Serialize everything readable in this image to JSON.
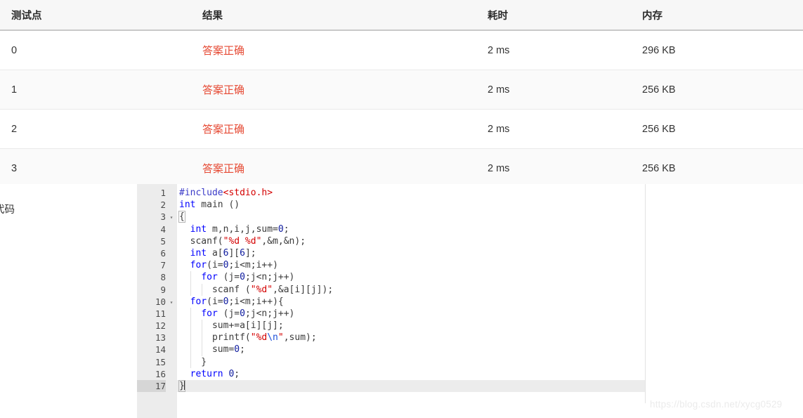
{
  "table": {
    "columns": [
      {
        "key": "case",
        "label": "测试点"
      },
      {
        "key": "result",
        "label": "结果"
      },
      {
        "key": "time",
        "label": "耗时"
      },
      {
        "key": "memory",
        "label": "内存"
      }
    ],
    "rows": [
      {
        "case": "0",
        "result": "答案正确",
        "time": "2 ms",
        "memory": "296 KB"
      },
      {
        "case": "1",
        "result": "答案正确",
        "time": "2 ms",
        "memory": "256 KB"
      },
      {
        "case": "2",
        "result": "答案正确",
        "time": "2 ms",
        "memory": "256 KB"
      },
      {
        "case": "3",
        "result": "答案正确",
        "time": "2 ms",
        "memory": "256 KB"
      }
    ],
    "verdict_color": "#e64a34"
  },
  "code_panel": {
    "label": "代码",
    "language": "c",
    "active_line": 17,
    "line_numbers": [
      "1",
      "2",
      "3",
      "4",
      "5",
      "6",
      "7",
      "8",
      "9",
      "10",
      "11",
      "12",
      "13",
      "14",
      "15",
      "16",
      "17"
    ],
    "fold_markers": {
      "3": "▾",
      "10": "▾"
    },
    "lines": [
      "#include<stdio.h>",
      "int main ()",
      "{",
      "  int m,n,i,j,sum=0;",
      "  scanf(\"%d %d\",&m,&n);",
      "  int a[6][6];",
      "  for(i=0;i<m;i++)",
      "    for (j=0;j<n;j++)",
      "      scanf (\"%d\",&a[i][j]);",
      "  for(i=0;i<m;i++){",
      "    for (j=0;j<n;j++)",
      "      sum+=a[i][j];",
      "      printf(\"%d\\n\",sum);",
      "      sum=0;",
      "    }",
      "  return 0;",
      "}"
    ],
    "colors": {
      "keyword": "#0000ff",
      "preprocessor": "#3b3bc8",
      "string": "#d40000",
      "escape": "#1e4fd8",
      "number": "#0d1a9e",
      "plain": "#3b3b3b",
      "gutter_bg": "#ececec",
      "active_line_bg": "#ececec"
    }
  },
  "watermark": {
    "text": "https://blog.csdn.net/xycg0529"
  }
}
